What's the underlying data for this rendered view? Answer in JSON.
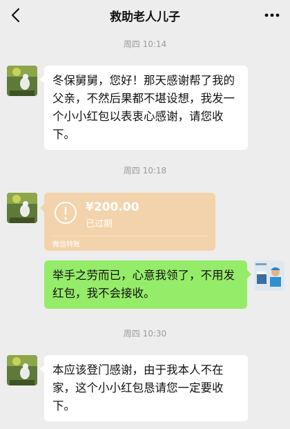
{
  "header": {
    "title": "救助老人儿子",
    "back_icon": "chevron-left-icon",
    "more_icon": "more-dots-icon"
  },
  "messages": {
    "time1": "周四 10:14",
    "msg1": "冬保舅舅，您好！那天感谢帮了我的父亲，不然后果都不堪设想，我发一个小小红包以表衷心感谢，请您收下。",
    "time2": "周四 10:18",
    "redpacket": {
      "amount": "¥200.00",
      "status": "已过期",
      "footer": "微信转账"
    },
    "msg2": "举手之劳而已，心意我领了，不用发红包，我不会接收。",
    "time3": "周四 10:30",
    "msg3": "本应该登门感谢，由于我本人不在家，这个小小红包恳请您一定要收下。"
  },
  "colors": {
    "background": "#ededed",
    "bubble_self": "#95ec69",
    "bubble_other": "#ffffff",
    "redpacket": "#f3d3ab"
  }
}
